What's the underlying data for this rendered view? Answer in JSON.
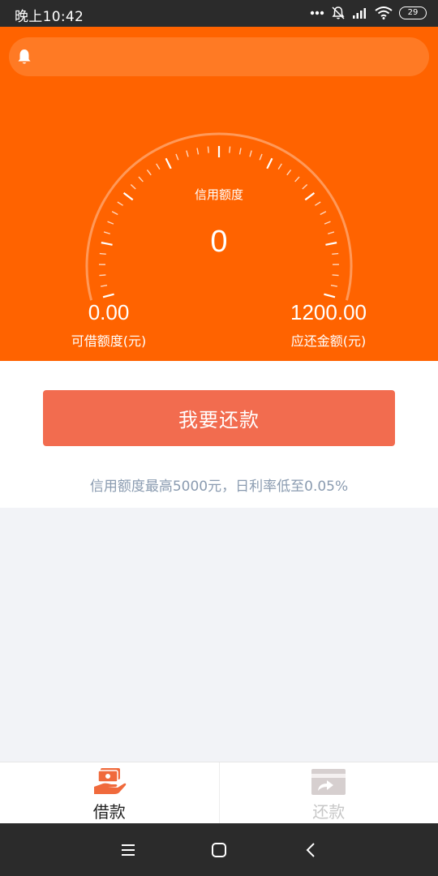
{
  "status_bar": {
    "time": "晚上10:42",
    "battery": "29"
  },
  "header": {
    "background_color": "#ff6300",
    "gauge": {
      "label": "信用额度",
      "value": "0"
    },
    "stats": [
      {
        "value": "0.00",
        "label": "可借额度(元)"
      },
      {
        "value": "1200.00",
        "label": "应还金额(元)"
      }
    ]
  },
  "main": {
    "repay_button_label": "我要还款",
    "repay_button_color": "#f26c4f",
    "promo_text": "信用额度最高5000元，日利率低至0.05%"
  },
  "tab_bar": {
    "tabs": [
      {
        "label": "借款",
        "icon": "loan-icon",
        "active": true
      },
      {
        "label": "还款",
        "icon": "repay-card-icon",
        "active": false
      }
    ]
  },
  "system_nav": {
    "buttons": [
      "menu-icon",
      "home-icon",
      "back-icon"
    ]
  }
}
